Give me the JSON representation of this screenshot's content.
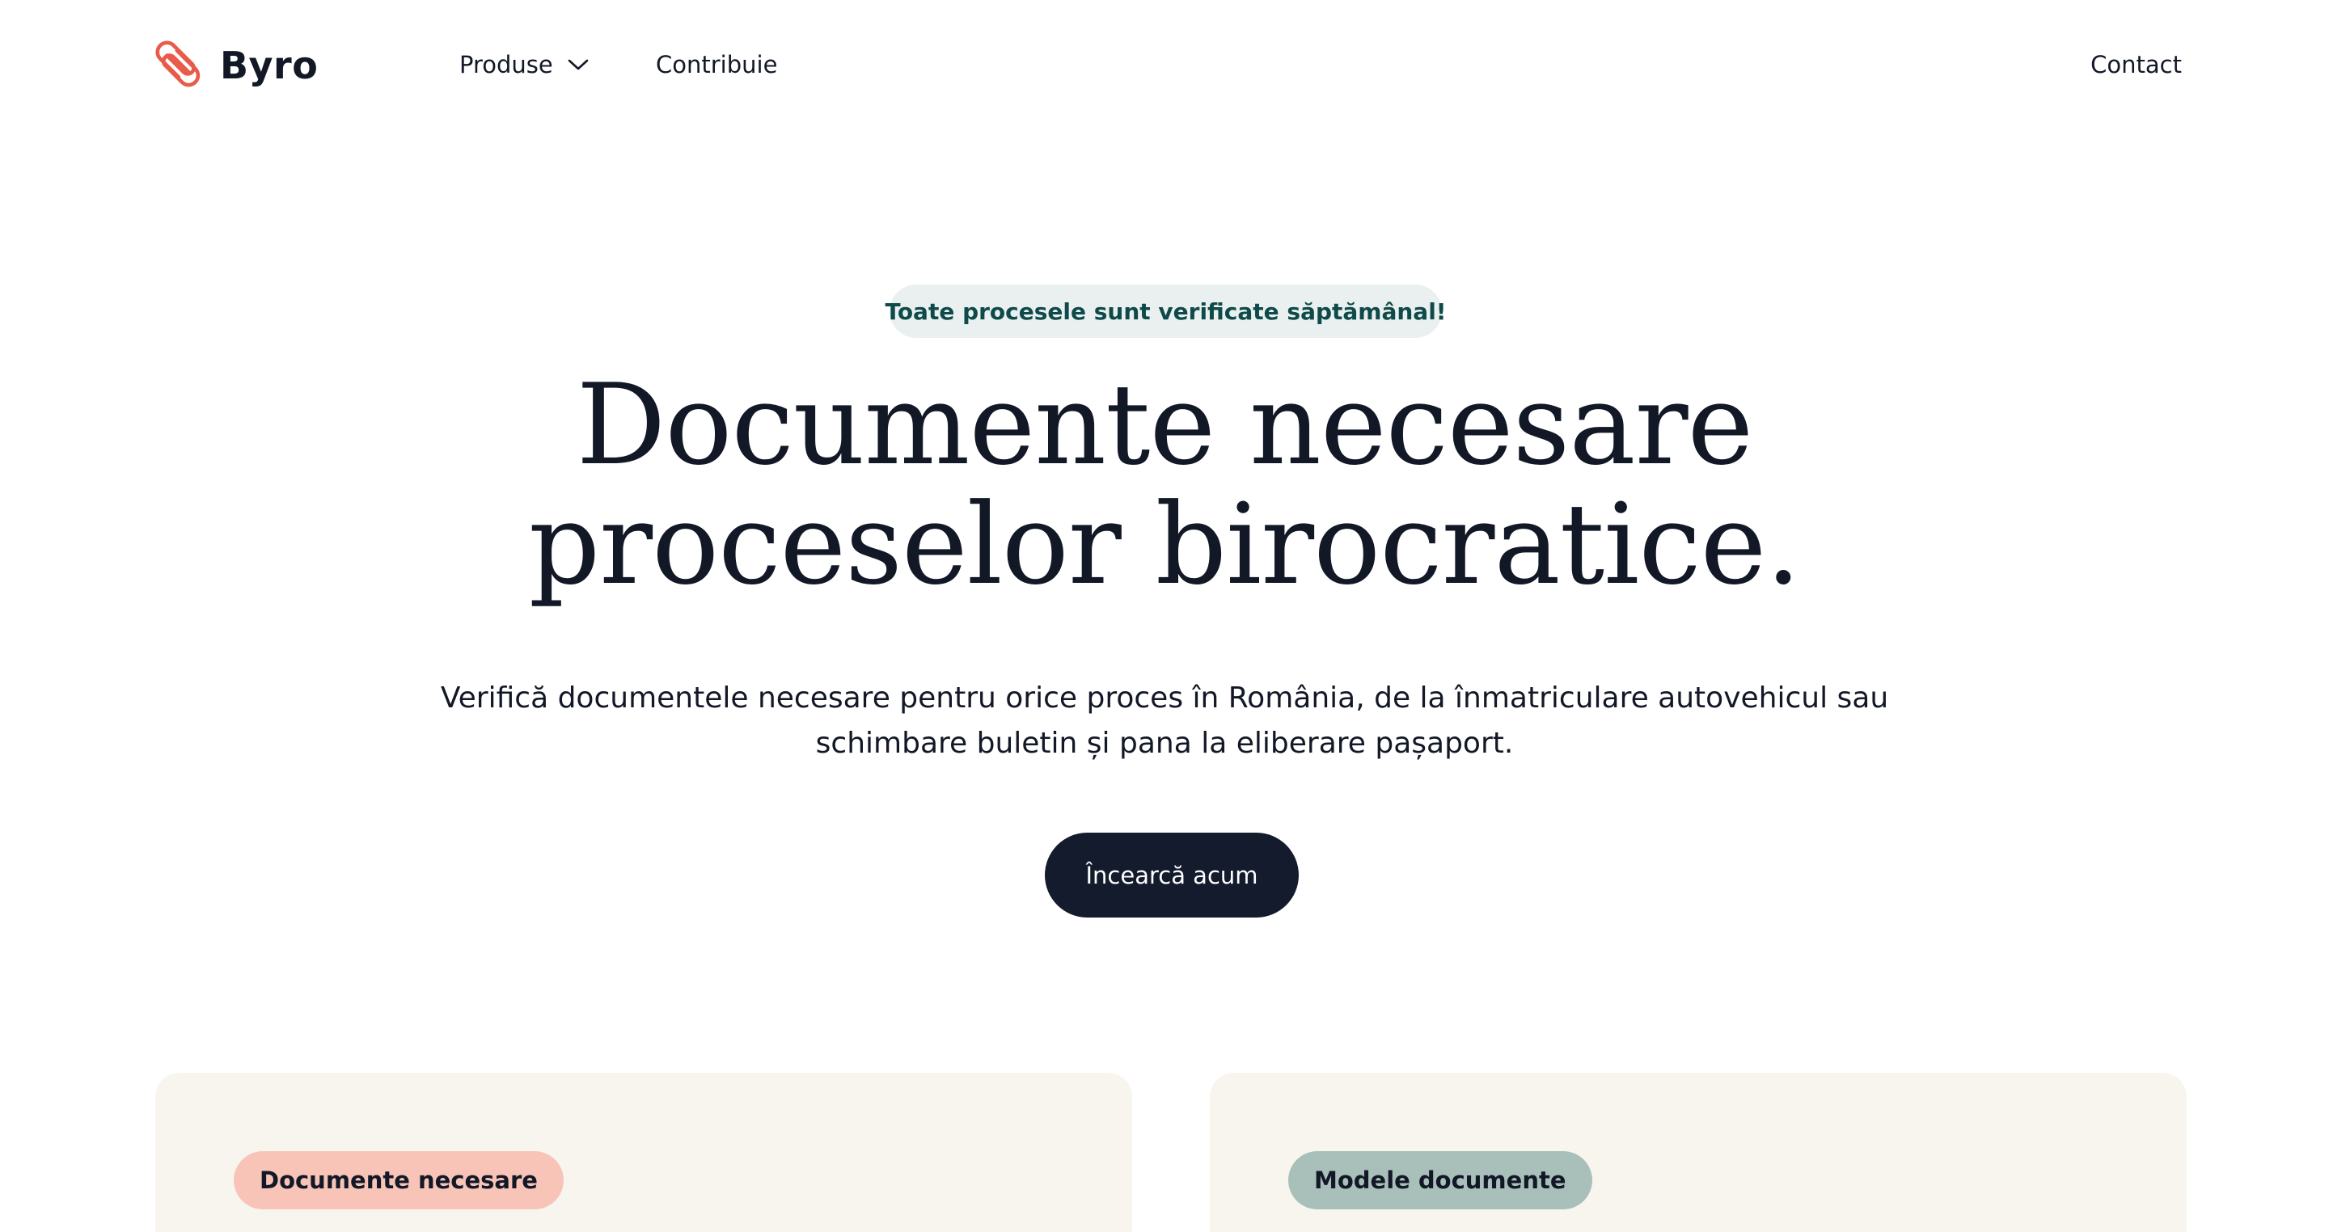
{
  "header": {
    "logo_text": "Byro",
    "nav": {
      "produse": "Produse",
      "contribuie": "Contribuie",
      "contact": "Contact"
    }
  },
  "hero": {
    "badge": "Toate procesele sunt verificate săptămânal!",
    "title_line1": "Documente necesare",
    "title_line2": "proceselor birocratice.",
    "subtitle_line1": "Verifică documentele necesare pentru orice proces în România, de la înmatriculare autovehicul sau",
    "subtitle_line2": "schimbare buletin și pana la eliberare pașaport.",
    "cta_label": "Încearcă acum"
  },
  "cards": [
    {
      "pill_label": "Documente necesare",
      "pill_color": "#f8c4b8"
    },
    {
      "pill_label": "Modele documente",
      "pill_color": "#a9bfba"
    }
  ],
  "colors": {
    "brand_logo": "#ea5a4a",
    "primary_dark": "#141b2d",
    "badge_bg": "#eaf0ef",
    "badge_text": "#0f4a4a",
    "card_bg": "#f8f5ee"
  },
  "icons": {
    "logo": "paperclip-logo-icon",
    "produse_dropdown": "chevron-down-icon"
  }
}
